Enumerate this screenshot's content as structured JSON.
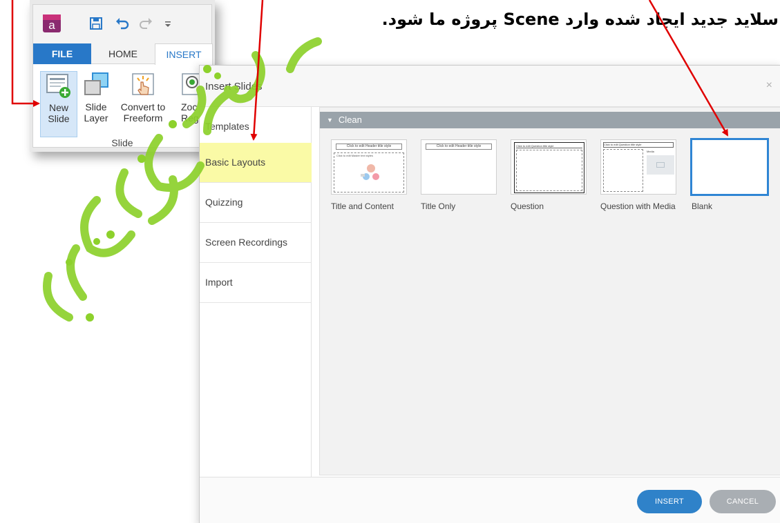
{
  "caption": "سلاید جدید ایجاد شده وارد Scene پروژه ما شود.",
  "ribbon": {
    "tabs": {
      "file": "FILE",
      "home": "HOME",
      "insert": "INSERT"
    },
    "buttons": [
      {
        "line1": "New",
        "line2": "Slide",
        "icon": "new-slide-icon"
      },
      {
        "line1": "Slide",
        "line2": "Layer",
        "icon": "slide-layer-icon"
      },
      {
        "line1": "Convert to",
        "line2": "Freeform",
        "icon": "convert-freeform-icon"
      },
      {
        "line1": "Zoc",
        "line2": "Regi",
        "icon": "zoom-region-icon"
      }
    ],
    "group_label": "Slide"
  },
  "dialog": {
    "title": "Insert Slides",
    "close": "×",
    "sidebar": [
      {
        "label": "Templates"
      },
      {
        "label": "Basic Layouts"
      },
      {
        "label": "Quizzing"
      },
      {
        "label": "Screen Recordings"
      },
      {
        "label": "Import"
      }
    ],
    "section": "Clean",
    "layouts": [
      {
        "label": "Title and Content",
        "header": "Click to edit Header title style",
        "body": "Click to edit Master text styles"
      },
      {
        "label": "Title Only",
        "header": "Click to edit Header title style"
      },
      {
        "label": "Question",
        "header": "Click to edit Question title style"
      },
      {
        "label": "Question with Media",
        "header": "Click to edit Question title style",
        "media": "Media"
      },
      {
        "label": "Blank"
      }
    ],
    "buttons": {
      "insert": "INSERT",
      "cancel": "CANCEL"
    }
  },
  "colors": {
    "accent": "#2f82c9",
    "file_tab": "#2878c8",
    "highlight": "#fafaa6",
    "arrow": "#e00000",
    "watermark": "#8dd12c"
  }
}
